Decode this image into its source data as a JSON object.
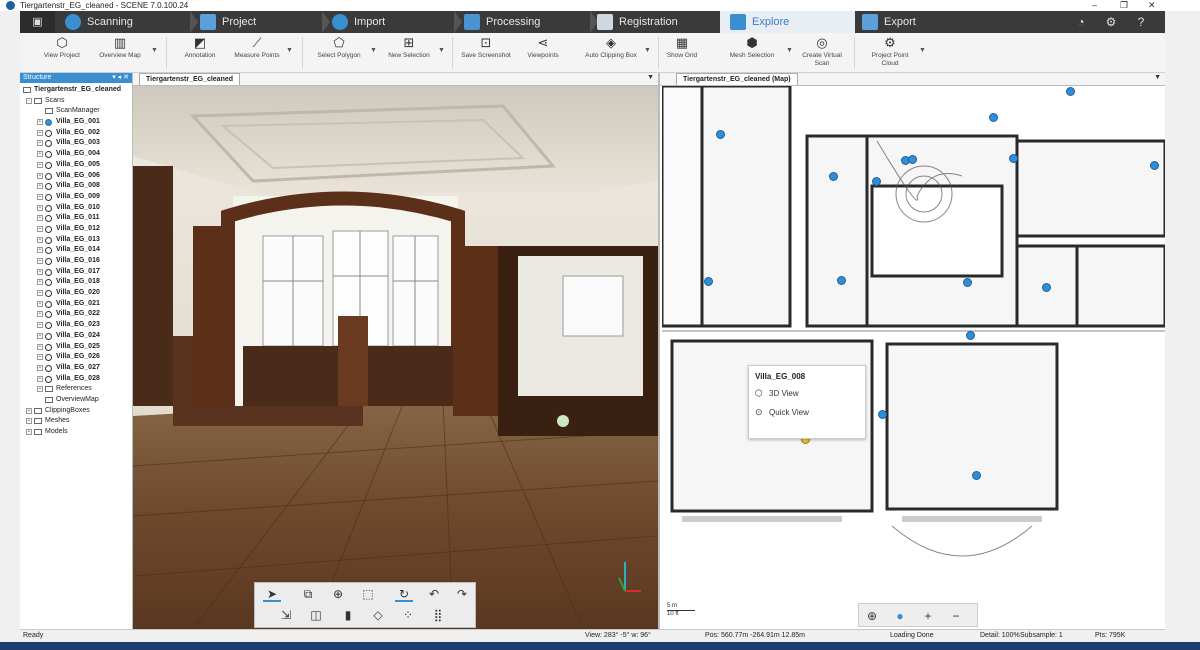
{
  "window": {
    "title": "Tiergartenstr_EG_cleaned - SCENE 7.0.100.24",
    "controls": [
      "–",
      "❐",
      "✕"
    ]
  },
  "tabs": [
    {
      "label": "Scanning",
      "icon": "scanner-icon"
    },
    {
      "label": "Project",
      "icon": "folder-icon"
    },
    {
      "label": "Import",
      "icon": "import-icon"
    },
    {
      "label": "Processing",
      "icon": "gears-icon"
    },
    {
      "label": "Registration",
      "icon": "registration-icon"
    },
    {
      "label": "Explore",
      "icon": "explore-icon",
      "active": true
    },
    {
      "label": "Export",
      "icon": "export-icon"
    }
  ],
  "ribbon": [
    {
      "label": "View Project",
      "icon": "cube-icon"
    },
    {
      "label": "Overview Map",
      "icon": "map-icon"
    },
    {
      "label": "Annotation",
      "icon": "annotation-icon"
    },
    {
      "label": "Measure Points",
      "icon": "measure-icon"
    },
    {
      "label": "Select Polygon",
      "icon": "polygon-icon"
    },
    {
      "label": "New Selection",
      "icon": "selection-icon"
    },
    {
      "label": "Save Screenshot",
      "icon": "camera-icon"
    },
    {
      "label": "Viewpoints",
      "icon": "viewpoints-icon"
    },
    {
      "label": "Auto Clipping Box",
      "icon": "clipping-box-icon"
    },
    {
      "label": "Show Grid",
      "icon": "grid-icon"
    },
    {
      "label": "Mesh Selection",
      "icon": "mesh-icon"
    },
    {
      "label": "Create Virtual Scan",
      "icon": "virtual-scan-icon"
    },
    {
      "label": "Project Point Cloud",
      "icon": "point-cloud-icon"
    }
  ],
  "structure": {
    "title": "Structure",
    "root": "Tiergartenstr_EG_cleaned",
    "scans_label": "Scans",
    "scan_manager": "ScanManager",
    "scans": [
      "Villa_EG_001",
      "Villa_EG_002",
      "Villa_EG_003",
      "Villa_EG_004",
      "Villa_EG_005",
      "Villa_EG_006",
      "Villa_EG_008",
      "Villa_EG_009",
      "Villa_EG_010",
      "Villa_EG_011",
      "Villa_EG_012",
      "Villa_EG_013",
      "Villa_EG_014",
      "Villa_EG_016",
      "Villa_EG_017",
      "Villa_EG_018",
      "Villa_EG_020",
      "Villa_EG_021",
      "Villa_EG_022",
      "Villa_EG_023",
      "Villa_EG_024",
      "Villa_EG_025",
      "Villa_EG_026",
      "Villa_EG_027",
      "Villa_EG_028"
    ],
    "after_scans": [
      "References",
      "OverviewMap"
    ],
    "groups": [
      "ClippingBoxes",
      "Meshes",
      "Models"
    ]
  },
  "view3d": {
    "tab": "Tiergartenstr_EG_cleaned"
  },
  "mapview": {
    "tab": "Tiergartenstr_EG_cleaned (Map)",
    "popup": {
      "title": "Villa_EG_008",
      "action1": "3D View",
      "action2": "Quick View"
    },
    "scale_m": "5 m",
    "scale_ft": "10 ft"
  },
  "status": {
    "left": "Ready",
    "view": "View: 283° -5° w: 96°",
    "pos": "Pos: 560.77m -264.91m 12.85m",
    "loading": "Loading Done",
    "detail": "Detail: 100%",
    "subsample": "Subsample: 1",
    "pts": "Pts: 795K"
  },
  "colors": {
    "accent": "#3a8fd0",
    "tabbar": "#3a3a3a",
    "scan_dot": "#2f8ed8",
    "selected_scan": "#f0c030"
  }
}
